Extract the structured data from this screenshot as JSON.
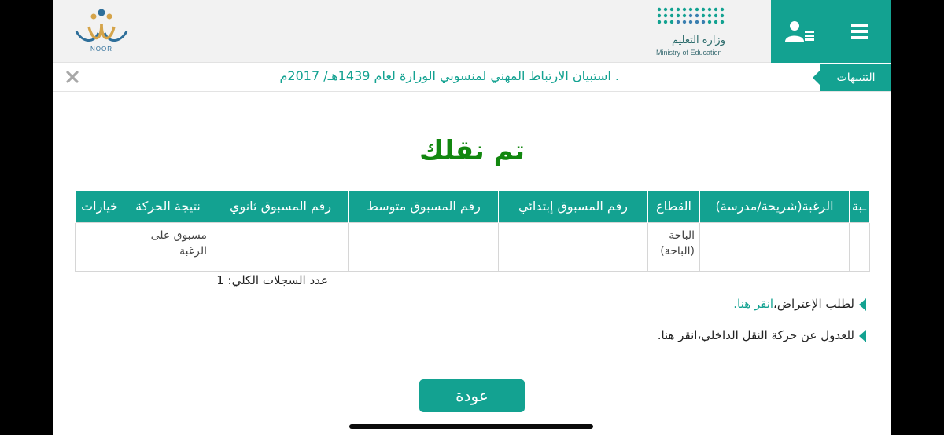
{
  "header": {
    "ministry_name_ar": "وزارة التعليم",
    "ministry_name_en": "Ministry of Education",
    "noor_label": "NOOR",
    "brand_color": "#13a291"
  },
  "notifications": {
    "label": "التنبيهات",
    "text": ". استبيان الارتباط المهني لمنسوبي الوزارة لعام 1439هـ/ 2017م",
    "close_icon": "close-icon"
  },
  "main": {
    "title": "تم نقلك",
    "title_color": "#12870f",
    "table": {
      "headers": [
        "ـبة",
        "الرغبة(شريحة/مدرسة)",
        "القطاع",
        "رقم المسبوق إبتدائي",
        "رقم المسبوق متوسط",
        "رقم المسبوق ثانوي",
        "نتيجة الحركة",
        "خيارات"
      ],
      "rows": [
        [
          "",
          "",
          "الباحة (الباحة)",
          "",
          "",
          "",
          "مسبوق على الرغبة",
          ""
        ]
      ]
    },
    "records_count": "عدد السجلات الكلي: 1",
    "objection": {
      "text": "لطلب الإعتراض،",
      "link": "انقر هنا."
    },
    "withdraw": {
      "text": "للعدول عن حركة النقل الداخلي،",
      "link": "انقر هنا."
    },
    "back_button": "عودة"
  }
}
